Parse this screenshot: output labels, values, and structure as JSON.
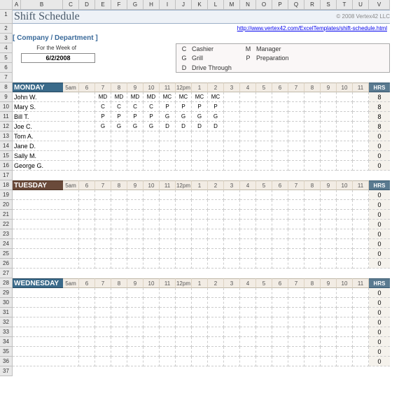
{
  "columns": [
    "A",
    "B",
    "C",
    "D",
    "E",
    "F",
    "G",
    "H",
    "I",
    "J",
    "K",
    "L",
    "M",
    "N",
    "O",
    "P",
    "Q",
    "R",
    "S",
    "T",
    "U",
    "V"
  ],
  "title": "Shift Schedule",
  "copyright": "© 2008 Vertex42 LLC",
  "link_text": "http://www.vertex42.com/ExcelTemplates/shift-schedule.html",
  "company": "[ Company / Department ]",
  "week_label": "For the Week of",
  "week_date": "6/2/2008",
  "legend": [
    {
      "code": "C",
      "label": "Cashier"
    },
    {
      "code": "G",
      "label": "Grill"
    },
    {
      "code": "D",
      "label": "Drive Through"
    },
    {
      "code": "M",
      "label": "Manager"
    },
    {
      "code": "P",
      "label": "Preparation"
    }
  ],
  "time_headers": [
    "5am",
    "6",
    "7",
    "8",
    "9",
    "10",
    "11",
    "12pm",
    "1",
    "2",
    "3",
    "4",
    "5",
    "6",
    "7",
    "8",
    "9",
    "10",
    "11"
  ],
  "hrs_label": "HRS",
  "days": [
    {
      "name": "MONDAY",
      "style": "mon",
      "rows": [
        {
          "emp": "John W.",
          "cells": [
            "",
            "",
            "MD",
            "MD",
            "MD",
            "MD",
            "MC",
            "MC",
            "MC",
            "MC",
            "",
            "",
            "",
            "",
            "",
            "",
            "",
            "",
            ""
          ],
          "hrs": "8"
        },
        {
          "emp": "Mary S.",
          "cells": [
            "",
            "",
            "C",
            "C",
            "C",
            "C",
            "P",
            "P",
            "P",
            "P",
            "",
            "",
            "",
            "",
            "",
            "",
            "",
            "",
            ""
          ],
          "hrs": "8"
        },
        {
          "emp": "Bill T.",
          "cells": [
            "",
            "",
            "P",
            "P",
            "P",
            "P",
            "G",
            "G",
            "G",
            "G",
            "",
            "",
            "",
            "",
            "",
            "",
            "",
            "",
            ""
          ],
          "hrs": "8"
        },
        {
          "emp": "Joe C.",
          "cells": [
            "",
            "",
            "G",
            "G",
            "G",
            "G",
            "D",
            "D",
            "D",
            "D",
            "",
            "",
            "",
            "",
            "",
            "",
            "",
            "",
            ""
          ],
          "hrs": "8"
        },
        {
          "emp": "Tom A.",
          "cells": [
            "",
            "",
            "",
            "",
            "",
            "",
            "",
            "",
            "",
            "",
            "",
            "",
            "",
            "",
            "",
            "",
            "",
            "",
            ""
          ],
          "hrs": "0"
        },
        {
          "emp": "Jane D.",
          "cells": [
            "",
            "",
            "",
            "",
            "",
            "",
            "",
            "",
            "",
            "",
            "",
            "",
            "",
            "",
            "",
            "",
            "",
            "",
            ""
          ],
          "hrs": "0"
        },
        {
          "emp": "Sally M.",
          "cells": [
            "",
            "",
            "",
            "",
            "",
            "",
            "",
            "",
            "",
            "",
            "",
            "",
            "",
            "",
            "",
            "",
            "",
            "",
            ""
          ],
          "hrs": "0"
        },
        {
          "emp": "George G.",
          "cells": [
            "",
            "",
            "",
            "",
            "",
            "",
            "",
            "",
            "",
            "",
            "",
            "",
            "",
            "",
            "",
            "",
            "",
            "",
            ""
          ],
          "hrs": "0"
        }
      ]
    },
    {
      "name": "TUESDAY",
      "style": "tue",
      "rows": [
        {
          "emp": "",
          "cells": [
            "",
            "",
            "",
            "",
            "",
            "",
            "",
            "",
            "",
            "",
            "",
            "",
            "",
            "",
            "",
            "",
            "",
            "",
            ""
          ],
          "hrs": "0"
        },
        {
          "emp": "",
          "cells": [
            "",
            "",
            "",
            "",
            "",
            "",
            "",
            "",
            "",
            "",
            "",
            "",
            "",
            "",
            "",
            "",
            "",
            "",
            ""
          ],
          "hrs": "0"
        },
        {
          "emp": "",
          "cells": [
            "",
            "",
            "",
            "",
            "",
            "",
            "",
            "",
            "",
            "",
            "",
            "",
            "",
            "",
            "",
            "",
            "",
            "",
            ""
          ],
          "hrs": "0"
        },
        {
          "emp": "",
          "cells": [
            "",
            "",
            "",
            "",
            "",
            "",
            "",
            "",
            "",
            "",
            "",
            "",
            "",
            "",
            "",
            "",
            "",
            "",
            ""
          ],
          "hrs": "0"
        },
        {
          "emp": "",
          "cells": [
            "",
            "",
            "",
            "",
            "",
            "",
            "",
            "",
            "",
            "",
            "",
            "",
            "",
            "",
            "",
            "",
            "",
            "",
            ""
          ],
          "hrs": "0"
        },
        {
          "emp": "",
          "cells": [
            "",
            "",
            "",
            "",
            "",
            "",
            "",
            "",
            "",
            "",
            "",
            "",
            "",
            "",
            "",
            "",
            "",
            "",
            ""
          ],
          "hrs": "0"
        },
        {
          "emp": "",
          "cells": [
            "",
            "",
            "",
            "",
            "",
            "",
            "",
            "",
            "",
            "",
            "",
            "",
            "",
            "",
            "",
            "",
            "",
            "",
            ""
          ],
          "hrs": "0"
        },
        {
          "emp": "",
          "cells": [
            "",
            "",
            "",
            "",
            "",
            "",
            "",
            "",
            "",
            "",
            "",
            "",
            "",
            "",
            "",
            "",
            "",
            "",
            ""
          ],
          "hrs": "0"
        }
      ]
    },
    {
      "name": "WEDNESDAY",
      "style": "wed",
      "rows": [
        {
          "emp": "",
          "cells": [
            "",
            "",
            "",
            "",
            "",
            "",
            "",
            "",
            "",
            "",
            "",
            "",
            "",
            "",
            "",
            "",
            "",
            "",
            ""
          ],
          "hrs": "0"
        },
        {
          "emp": "",
          "cells": [
            "",
            "",
            "",
            "",
            "",
            "",
            "",
            "",
            "",
            "",
            "",
            "",
            "",
            "",
            "",
            "",
            "",
            "",
            ""
          ],
          "hrs": "0"
        },
        {
          "emp": "",
          "cells": [
            "",
            "",
            "",
            "",
            "",
            "",
            "",
            "",
            "",
            "",
            "",
            "",
            "",
            "",
            "",
            "",
            "",
            "",
            ""
          ],
          "hrs": "0"
        },
        {
          "emp": "",
          "cells": [
            "",
            "",
            "",
            "",
            "",
            "",
            "",
            "",
            "",
            "",
            "",
            "",
            "",
            "",
            "",
            "",
            "",
            "",
            ""
          ],
          "hrs": "0"
        },
        {
          "emp": "",
          "cells": [
            "",
            "",
            "",
            "",
            "",
            "",
            "",
            "",
            "",
            "",
            "",
            "",
            "",
            "",
            "",
            "",
            "",
            "",
            ""
          ],
          "hrs": "0"
        },
        {
          "emp": "",
          "cells": [
            "",
            "",
            "",
            "",
            "",
            "",
            "",
            "",
            "",
            "",
            "",
            "",
            "",
            "",
            "",
            "",
            "",
            "",
            ""
          ],
          "hrs": "0"
        },
        {
          "emp": "",
          "cells": [
            "",
            "",
            "",
            "",
            "",
            "",
            "",
            "",
            "",
            "",
            "",
            "",
            "",
            "",
            "",
            "",
            "",
            "",
            ""
          ],
          "hrs": "0"
        },
        {
          "emp": "",
          "cells": [
            "",
            "",
            "",
            "",
            "",
            "",
            "",
            "",
            "",
            "",
            "",
            "",
            "",
            "",
            "",
            "",
            "",
            "",
            ""
          ],
          "hrs": "0"
        }
      ]
    }
  ]
}
